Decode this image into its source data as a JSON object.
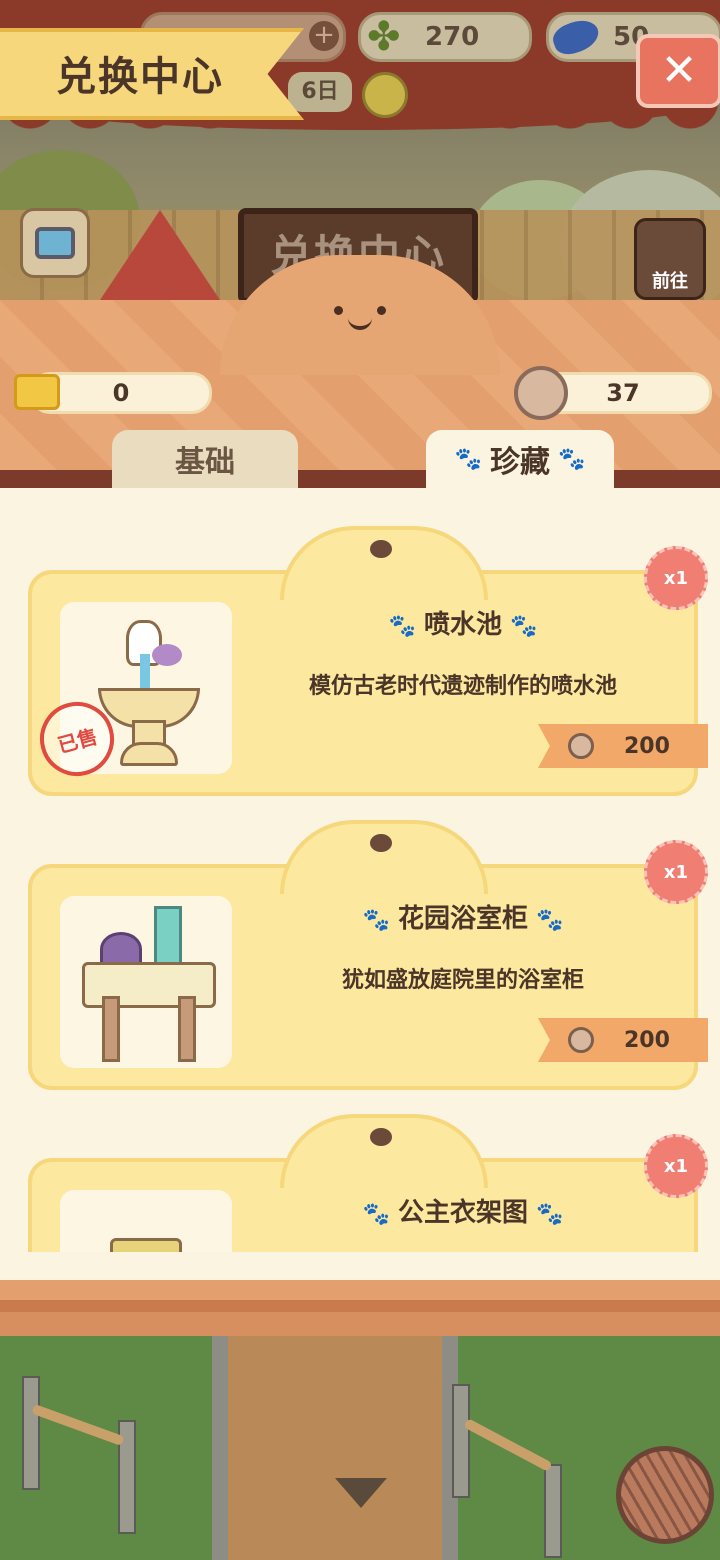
{
  "top_bar": {
    "title": "兑换中心",
    "clover_count": "270",
    "fish_count": "50",
    "day_chip": "6日",
    "sign_text": "兑换中心",
    "go_label": "前往"
  },
  "currency": {
    "tickets": "0",
    "coins": "37"
  },
  "tabs": [
    {
      "label": "基础",
      "active": false
    },
    {
      "label": "珍藏",
      "active": true
    }
  ],
  "items": [
    {
      "name": "喷水池",
      "desc": "模仿古老时代遗迹制作的喷水池",
      "price": "200",
      "qty": "x1",
      "sold_label": "已售",
      "icon": "fountain-icon"
    },
    {
      "name": "花园浴室柜",
      "desc": "犹如盛放庭院里的浴室柜",
      "price": "200",
      "qty": "x1",
      "icon": "bathroom-cabinet-icon"
    },
    {
      "name": "公主衣架图",
      "desc": "",
      "price": "",
      "qty": "x1",
      "icon": "hanger-icon"
    }
  ],
  "colors": {
    "accent": "#f6d77b",
    "card": "#fce89e",
    "price_tag": "#f2a869",
    "badge": "#f07e72"
  }
}
